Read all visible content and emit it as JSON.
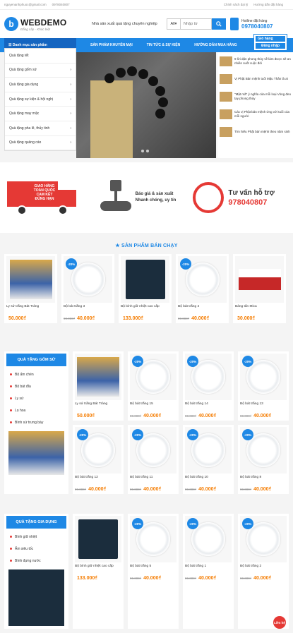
{
  "topbar": {
    "email": "nguyenanhphuoc@gmail.com",
    "phone": "0978040807",
    "policy": "Chính sách đại lý",
    "guide": "Hướng dẫn đặt hàng"
  },
  "header": {
    "logo": "WEBDEMO",
    "tagline": "Đẳng cấp - Khác biệt",
    "slogan": "Nhà sản xuất quà tặng chuyên nghiệp",
    "search_select": "All",
    "search_placeholder": "Nhập từ",
    "hotline_label": "Hotline đặt hàng",
    "hotline": "0978040807"
  },
  "nav": {
    "category": "Danh mục sản phẩm",
    "items": [
      "SẢN PHẨM KHUYẾN MẠI",
      "TIN TỨC & SỰ KIỆN",
      "HƯỚNG DẪN MUA HÀNG"
    ],
    "cart": "Giỏ hàng",
    "login": "Đăng nhập"
  },
  "catmenu": [
    "Quà tặng tết",
    "Quà tặng gốm sứ",
    "Quà tặng gia dụng",
    "Quà tặng sự kiện & hội nghị",
    "Quà tặng may mặc",
    "Quà tặng pha lê, thủy tinh",
    "Quà tặng quảng cáo"
  ],
  "news": [
    "9 lời dặn phong thủy về làm được sẽ an nhiên suốt cuộc đời",
    "Vị Phật Bản mệnh tuổi Mậu Thân là ai",
    "\"Mật mã\" ý nghĩa của mỗi loại Vòng đeo tay phong thủy",
    "Các vị Phật bản mệnh ứng với tuổi của mỗi người",
    "Tìm hiểu Phật bản mệnh theo năm sinh"
  ],
  "banner": {
    "truck_text": "GIAO HÀNG TOÀN QUỐC CAM KẾT ĐÚNG HẠN",
    "factory_line1": "Báo giá & sản xuất",
    "factory_line2": "Nhanh chóng, uy tín",
    "support_title": "Tư vấn hỗ trợ",
    "support_phone": "978040807"
  },
  "bestsell": {
    "title": "SẢN PHẨM BÁN CHẠY",
    "products": [
      {
        "name": "Ly sứ trắng Bát Tràng",
        "old": "",
        "price": "50.000₫",
        "disc": ""
      },
      {
        "name": "Bộ bát trắng 3",
        "old": "90.000₫",
        "price": "40.000₫",
        "disc": "-20%"
      },
      {
        "name": "Bộ bình giữ nhiệt cao cấp",
        "old": "",
        "price": "133.000₫",
        "disc": ""
      },
      {
        "name": "Bộ bát trắng 4",
        "old": "90.000₫",
        "price": "40.000₫",
        "disc": "-20%"
      },
      {
        "name": "Bàng tấn Mica",
        "old": "",
        "price": "30.000₫",
        "disc": ""
      }
    ]
  },
  "gomsu": {
    "title": "QUÀ TẶNG GỐM SỨ",
    "links": [
      "Bộ ấm chén",
      "Bộ bát đĩa",
      "Ly sứ",
      "Lọ hoa",
      "Bình sứ trưng bày"
    ],
    "products": [
      {
        "name": "Ly sứ trắng Bát Tràng",
        "old": "",
        "price": "50.000₫",
        "disc": ""
      },
      {
        "name": "Bộ bát trắng 15",
        "old": "90.000₫",
        "price": "40.000₫",
        "disc": "-20%"
      },
      {
        "name": "Bộ bát trắng 14",
        "old": "90.000₫",
        "price": "40.000₫",
        "disc": "-20%"
      },
      {
        "name": "Bộ bát trắng 13",
        "old": "90.000₫",
        "price": "40.000₫",
        "disc": "-20%"
      },
      {
        "name": "Bộ bát trắng 12",
        "old": "90.000₫",
        "price": "40.000₫",
        "disc": "-20%"
      },
      {
        "name": "Bộ bát trắng 11",
        "old": "90.000₫",
        "price": "40.000₫",
        "disc": "-20%"
      },
      {
        "name": "Bộ bát trắng 10",
        "old": "90.000₫",
        "price": "40.000₫",
        "disc": "-20%"
      },
      {
        "name": "Bộ bát trắng 8",
        "old": "90.000₫",
        "price": "40.000₫",
        "disc": "-20%"
      }
    ]
  },
  "giadung": {
    "title": "QUÀ TẶNG GIA DỤNG",
    "links": [
      "Bình giữ nhiệt",
      "Ấm siêu tốc",
      "Bình đựng nước"
    ],
    "products": [
      {
        "name": "Bộ bình giữ nhiệt cao cấp",
        "old": "",
        "price": "133.000₫",
        "disc": ""
      },
      {
        "name": "Bộ bát trắng 5",
        "old": "90.000₫",
        "price": "40.000₫",
        "disc": "-20%"
      },
      {
        "name": "Bộ bát trắng 1",
        "old": "90.000₫",
        "price": "40.000₫",
        "disc": "-20%"
      },
      {
        "name": "Bộ bát trắng 2",
        "old": "90.000₫",
        "price": "40.000₫",
        "disc": "-20%"
      }
    ]
  },
  "chat": "Liên hệ"
}
